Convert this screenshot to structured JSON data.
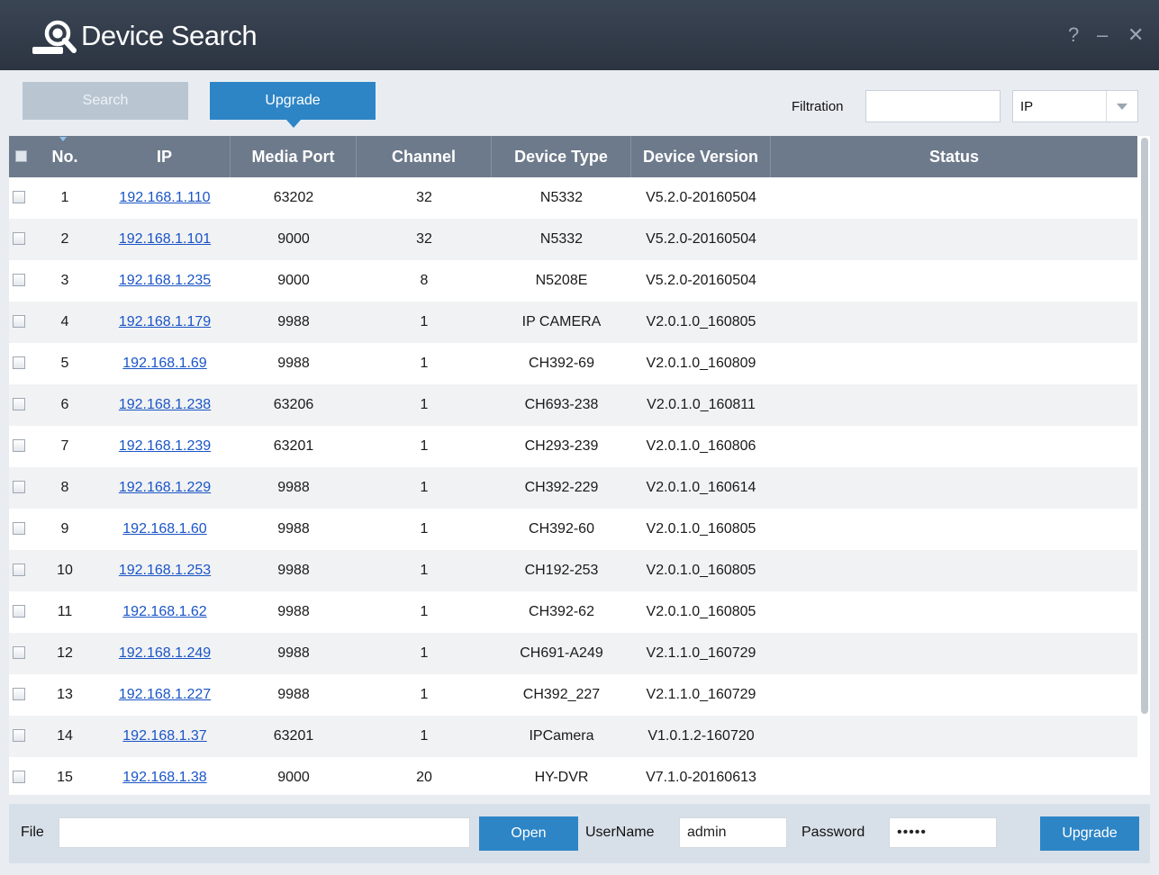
{
  "window": {
    "title": "Device Search",
    "help_label": "?",
    "minimize_label": "–",
    "close_label": "✕"
  },
  "toolbar": {
    "search_label": "Search",
    "upgrade_tab_label": "Upgrade",
    "filtration_label": "Filtration",
    "filtration_value": "",
    "filter_type_selected": "IP"
  },
  "table": {
    "columns": [
      "No.",
      "IP",
      "Media Port",
      "Channel",
      "Device Type",
      "Device Version",
      "Status"
    ],
    "rows": [
      {
        "no": "1",
        "ip": "192.168.1.110",
        "port": "63202",
        "channel": "32",
        "type": "N5332",
        "version": "V5.2.0-20160504",
        "status": ""
      },
      {
        "no": "2",
        "ip": "192.168.1.101",
        "port": "9000",
        "channel": "32",
        "type": "N5332",
        "version": "V5.2.0-20160504",
        "status": ""
      },
      {
        "no": "3",
        "ip": "192.168.1.235",
        "port": "9000",
        "channel": "8",
        "type": "N5208E",
        "version": "V5.2.0-20160504",
        "status": ""
      },
      {
        "no": "4",
        "ip": "192.168.1.179",
        "port": "9988",
        "channel": "1",
        "type": "IP CAMERA",
        "version": "V2.0.1.0_160805",
        "status": ""
      },
      {
        "no": "5",
        "ip": "192.168.1.69",
        "port": "9988",
        "channel": "1",
        "type": "CH392-69",
        "version": "V2.0.1.0_160809",
        "status": ""
      },
      {
        "no": "6",
        "ip": "192.168.1.238",
        "port": "63206",
        "channel": "1",
        "type": "CH693-238",
        "version": "V2.0.1.0_160811",
        "status": ""
      },
      {
        "no": "7",
        "ip": "192.168.1.239",
        "port": "63201",
        "channel": "1",
        "type": "CH293-239",
        "version": "V2.0.1.0_160806",
        "status": ""
      },
      {
        "no": "8",
        "ip": "192.168.1.229",
        "port": "9988",
        "channel": "1",
        "type": "CH392-229",
        "version": "V2.0.1.0_160614",
        "status": ""
      },
      {
        "no": "9",
        "ip": "192.168.1.60",
        "port": "9988",
        "channel": "1",
        "type": "CH392-60",
        "version": "V2.0.1.0_160805",
        "status": ""
      },
      {
        "no": "10",
        "ip": "192.168.1.253",
        "port": "9988",
        "channel": "1",
        "type": "CH192-253",
        "version": "V2.0.1.0_160805",
        "status": ""
      },
      {
        "no": "11",
        "ip": "192.168.1.62",
        "port": "9988",
        "channel": "1",
        "type": "CH392-62",
        "version": "V2.0.1.0_160805",
        "status": ""
      },
      {
        "no": "12",
        "ip": "192.168.1.249",
        "port": "9988",
        "channel": "1",
        "type": "CH691-A249",
        "version": "V2.1.1.0_160729",
        "status": ""
      },
      {
        "no": "13",
        "ip": "192.168.1.227",
        "port": "9988",
        "channel": "1",
        "type": "CH392_227",
        "version": "V2.1.1.0_160729",
        "status": ""
      },
      {
        "no": "14",
        "ip": "192.168.1.37",
        "port": "63201",
        "channel": "1",
        "type": "IPCamera",
        "version": "V1.0.1.2-160720",
        "status": ""
      },
      {
        "no": "15",
        "ip": "192.168.1.38",
        "port": "9000",
        "channel": "20",
        "type": "HY-DVR",
        "version": "V7.1.0-20160613",
        "status": ""
      }
    ]
  },
  "bottom": {
    "file_label": "File",
    "file_value": "",
    "open_label": "Open",
    "username_label": "UserName",
    "username_value": "admin",
    "password_label": "Password",
    "password_value": "•••••",
    "upgrade_label": "Upgrade"
  },
  "colors": {
    "titlebar": "#313a47",
    "accent": "#2d85c6",
    "header": "#6d7a8b",
    "link": "#1a55c6"
  }
}
